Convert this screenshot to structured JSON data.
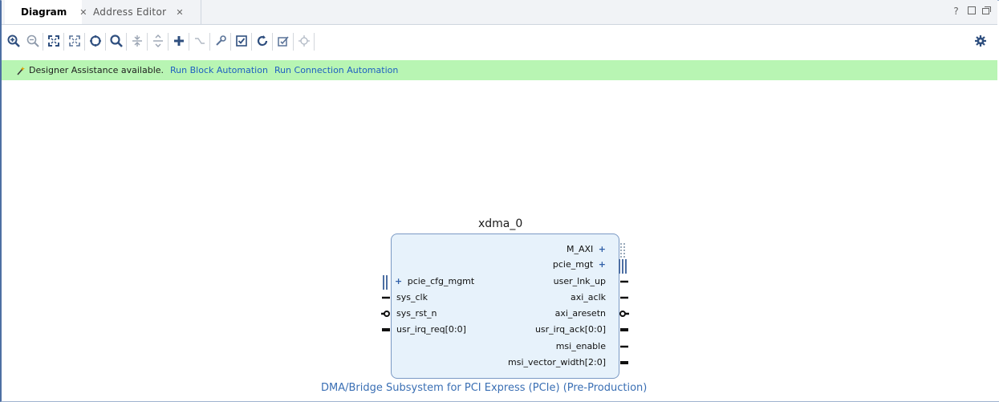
{
  "tabs": [
    {
      "label": "Diagram",
      "active": true
    },
    {
      "label": "Address Editor",
      "active": false
    }
  ],
  "window_controls": [
    "?",
    "restore",
    "maximize"
  ],
  "toolbar": {
    "buttons": [
      "zoom-in-icon",
      "zoom-out-icon",
      "zoom-fit-icon",
      "auto-fit-selection-icon",
      "select-area-icon",
      "search-icon",
      "expand-icon",
      "collapse-icon",
      "add-ip-icon",
      "make-connection-icon",
      "settings-wrench-icon",
      "validate-design-icon",
      "regenerate-layout-icon",
      "optimize-routing-icon",
      "pin-icon"
    ]
  },
  "assistance": {
    "message": "Designer Assistance available.",
    "links": [
      "Run Block Automation",
      "Run Connection Automation"
    ]
  },
  "block": {
    "name": "xdma_0",
    "subtitle": "DMA/Bridge Subsystem for PCI Express (PCIe) (Pre-Production)",
    "left_ports": [
      {
        "label": "pcie_cfg_mgmt",
        "type": "bus-plus"
      },
      {
        "label": "sys_clk",
        "type": "wire"
      },
      {
        "label": "sys_rst_n",
        "type": "inverted"
      },
      {
        "label": "usr_irq_req[0:0]",
        "type": "bus"
      }
    ],
    "right_ports": [
      {
        "label": "M_AXI",
        "type": "bus-plus"
      },
      {
        "label": "pcie_mgt",
        "type": "bus-plus"
      },
      {
        "label": "user_lnk_up",
        "type": "wire"
      },
      {
        "label": "axi_aclk",
        "type": "wire"
      },
      {
        "label": "axi_aresetn",
        "type": "inverted"
      },
      {
        "label": "usr_irq_ack[0:0]",
        "type": "bus"
      },
      {
        "label": "msi_enable",
        "type": "wire"
      },
      {
        "label": "msi_vector_width[2:0]",
        "type": "bus"
      }
    ]
  },
  "colors": {
    "assist_bg": "#b8f5b3",
    "link": "#1e5fc1",
    "block_fill": "#e7f2fb",
    "block_border": "#7a99c4",
    "subtitle": "#3a6fb4"
  }
}
